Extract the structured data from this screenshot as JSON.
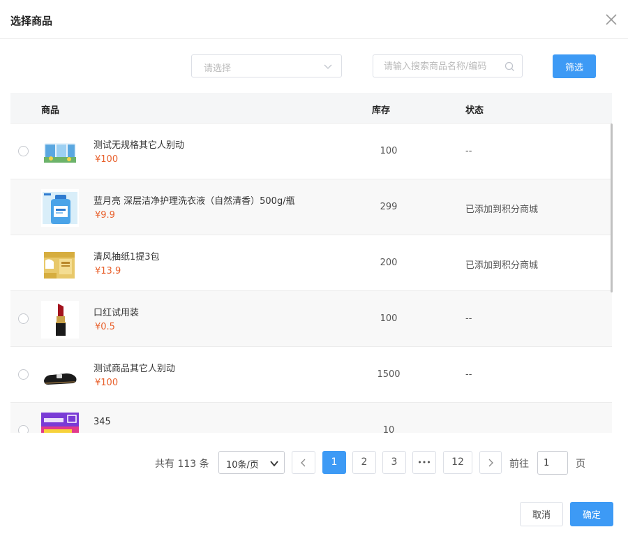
{
  "dialog": {
    "title": "选择商品"
  },
  "filters": {
    "select_placeholder": "请选择",
    "search_placeholder": "请输入搜索商品名称/编码",
    "filter_button": "筛选"
  },
  "table": {
    "headers": {
      "product": "商品",
      "stock": "库存",
      "status": "状态"
    },
    "rows": [
      {
        "name": "测试无规格其它人别动",
        "price": "¥100",
        "stock": "100",
        "status": "--",
        "selectable": true,
        "image": "tissue-pack"
      },
      {
        "name": "蓝月亮 深层洁净护理洗衣液（自然清香）500g/瓶",
        "price": "¥9.9",
        "stock": "299",
        "status": "已添加到积分商城",
        "selectable": false,
        "image": "detergent-bottle"
      },
      {
        "name": "清风抽纸1提3包",
        "price": "¥13.9",
        "stock": "200",
        "status": "已添加到积分商城",
        "selectable": false,
        "image": "tissue-box"
      },
      {
        "name": "口红试用装",
        "price": "¥0.5",
        "stock": "100",
        "status": "--",
        "selectable": true,
        "image": "lipstick"
      },
      {
        "name": "测试商品其它人别动",
        "price": "¥100",
        "stock": "1500",
        "status": "--",
        "selectable": true,
        "image": "shoe"
      },
      {
        "name": "345",
        "price": "",
        "stock": "10",
        "status": "",
        "selectable": true,
        "image": "vip-banner"
      }
    ]
  },
  "pagination": {
    "total_text": "共有 113 条",
    "page_size": "10条/页",
    "pages": [
      "1",
      "2",
      "3",
      "•••",
      "12"
    ],
    "current_page": "1",
    "goto_label": "前往",
    "goto_value": "1",
    "page_unit": "页"
  },
  "footer": {
    "cancel": "取消",
    "confirm": "确定"
  },
  "colors": {
    "primary": "#3d9af5",
    "price": "#e8602c",
    "header_bg": "#f5f6f7"
  }
}
